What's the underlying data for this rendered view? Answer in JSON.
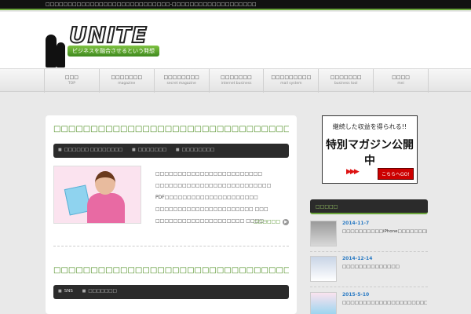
{
  "topbar": {
    "text": "□□□□□□□□□□□□□□□□□□□□□□□□□□□□-□□□□□□□□□□□□□□□□□□□"
  },
  "header": {
    "brand": "UNITE",
    "tagline": "ビジネスを融合させるという発想"
  },
  "nav": {
    "items": [
      {
        "jp": "□□□",
        "en": "TOP"
      },
      {
        "jp": "□□□□□□□",
        "en": "magazine"
      },
      {
        "jp": "□□□□□□□□",
        "en": "secret magazine"
      },
      {
        "jp": "□□□□□□□",
        "en": "internet business"
      },
      {
        "jp": "□□□□□□□□□",
        "en": "mail system"
      },
      {
        "jp": "□□□□□□□",
        "en": "business tool"
      },
      {
        "jp": "□□□□",
        "en": "mei"
      }
    ]
  },
  "posts": [
    {
      "title": "□□□□□□□□□□□□□□□□□□□□□□□□□□□□□□□□□□□□□□□□□□",
      "meta": [
        "□□□□□□ □□□□□□□□",
        "□□□□□□□",
        "□□□□□□□□"
      ],
      "excerpt": "□□□□□□□□□□□□□□□□□□□□□□□□ □□□□□□□□□□□□□□□□□□□□□□□□□□ PDF□□□□□□□□□□□□□□□□□□□□□ □□□□□□□□□□□□□□□□□□□□□□ □□□ □□□□□□□□□□□□□□□□□□□□ □□□□…",
      "readmore": "□□□□□□"
    },
    {
      "title": "□□□□□□□□□□□□□□□□□□□□□□□□□□□□□□□□□□",
      "meta": [
        "SNS",
        "□□□□□□□"
      ]
    }
  ],
  "ad": {
    "line1": "継続した収益を得られる!!",
    "line2": "特別マガジン公開中",
    "arrows": "▶▶▶",
    "cta": "こちらへGO!"
  },
  "sidebar": {
    "widget_title": "□□□□□",
    "items": [
      {
        "date": "2014-11-7",
        "title": "□□□□□□□□□□iPhone□□□□□□□□□□□□□□□□□□□□□□□□□"
      },
      {
        "date": "2014-12-14",
        "title": "□□□□□□□□□□□□□□"
      },
      {
        "date": "2015-5-10",
        "title": "□□□□□□□□□□□□□□□□□□□□□□□□□□□□□□□□□□□□□"
      }
    ]
  },
  "colors": {
    "accent": "#6aa53a",
    "link": "#4a8c1c",
    "date": "#2b7bc4",
    "dark": "#2b2b2b"
  }
}
